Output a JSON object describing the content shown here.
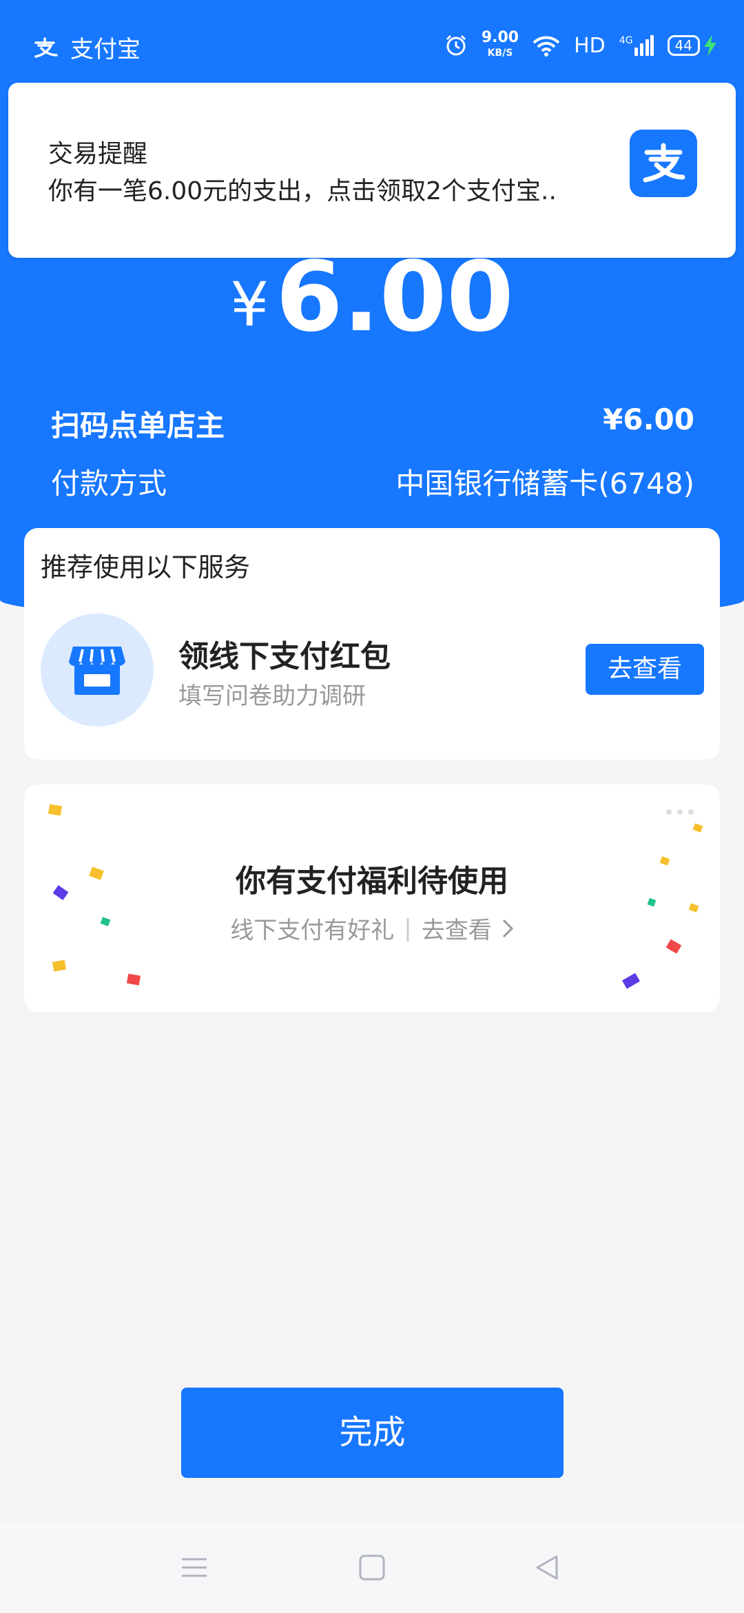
{
  "status_bar": {
    "app_name": "支付宝",
    "speed_value": "9.00",
    "speed_unit": "KB/S",
    "hd": "HD",
    "network": "4G",
    "battery": "44"
  },
  "notification": {
    "title": "交易提醒",
    "body": "你有一笔6.00元的支出，点击领取2个支付宝.."
  },
  "payment": {
    "currency_symbol": "¥",
    "amount": "6.00",
    "merchant_label": "扫码点单店主",
    "merchant_amount": "¥6.00",
    "method_label": "付款方式",
    "method_value": "中国银行储蓄卡(6748)"
  },
  "services": {
    "header": "推荐使用以下服务",
    "item_title": "领线下支付红包",
    "item_subtitle": "填写问卷助力调研",
    "item_button": "去查看"
  },
  "benefit": {
    "title": "你有支付福利待使用",
    "subtitle": "线下支付有好礼",
    "link": "去查看"
  },
  "done_button": "完成",
  "colors": {
    "brand_blue": "#1777ff",
    "page_bg": "#f4f4f4"
  }
}
